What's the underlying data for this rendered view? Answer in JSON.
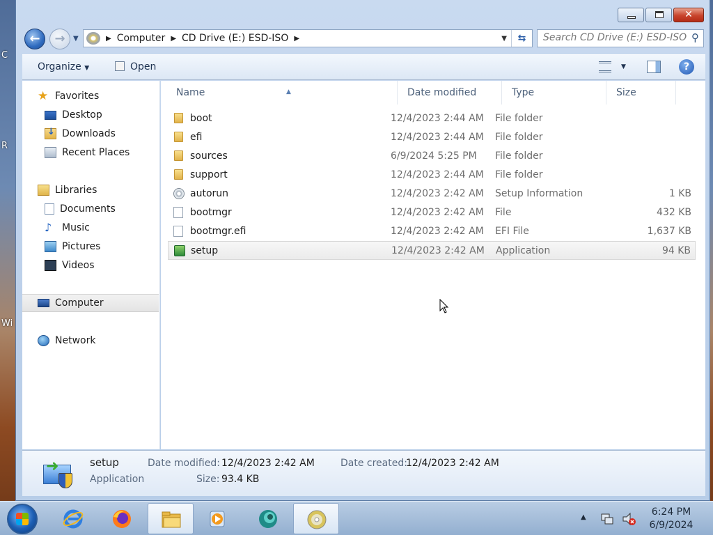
{
  "desktop": {
    "fragments": [
      "C",
      "R",
      "Wi"
    ]
  },
  "window": {
    "nav": {
      "back_glyph": "←",
      "fwd_glyph": "→"
    },
    "address": {
      "crumbs": [
        "Computer",
        "CD Drive (E:) ESD-ISO"
      ],
      "separator": "▶"
    },
    "search": {
      "placeholder": "Search CD Drive (E:) ESD-ISO"
    },
    "toolbar": {
      "organize": "Organize",
      "open": "Open"
    },
    "caption": {
      "close_glyph": "✕"
    }
  },
  "navpane": {
    "favorites": {
      "label": "Favorites",
      "items": [
        "Desktop",
        "Downloads",
        "Recent Places"
      ]
    },
    "libraries": {
      "label": "Libraries",
      "items": [
        "Documents",
        "Music",
        "Pictures",
        "Videos"
      ]
    },
    "computer": "Computer",
    "network": "Network"
  },
  "filelist": {
    "columns": [
      "Name",
      "Date modified",
      "Type",
      "Size"
    ],
    "rows": [
      {
        "name": "boot",
        "date": "12/4/2023 2:44 AM",
        "type": "File folder",
        "size": "",
        "icon": "folder-icon"
      },
      {
        "name": "efi",
        "date": "12/4/2023 2:44 AM",
        "type": "File folder",
        "size": "",
        "icon": "folder-icon"
      },
      {
        "name": "sources",
        "date": "6/9/2024 5:25 PM",
        "type": "File folder",
        "size": "",
        "icon": "folder-icon"
      },
      {
        "name": "support",
        "date": "12/4/2023 2:44 AM",
        "type": "File folder",
        "size": "",
        "icon": "folder-icon"
      },
      {
        "name": "autorun",
        "date": "12/4/2023 2:42 AM",
        "type": "Setup Information",
        "size": "1 KB",
        "icon": "setup-info-icon"
      },
      {
        "name": "bootmgr",
        "date": "12/4/2023 2:42 AM",
        "type": "File",
        "size": "432 KB",
        "icon": "file-icon"
      },
      {
        "name": "bootmgr.efi",
        "date": "12/4/2023 2:42 AM",
        "type": "EFI File",
        "size": "1,637 KB",
        "icon": "file-icon"
      },
      {
        "name": "setup",
        "date": "12/4/2023 2:42 AM",
        "type": "Application",
        "size": "94 KB",
        "icon": "application-icon"
      }
    ],
    "selected_index": 7
  },
  "details": {
    "name": "setup",
    "type": "Application",
    "date_modified_label": "Date modified:",
    "date_modified": "12/4/2023 2:42 AM",
    "date_created_label": "Date created:",
    "date_created": "12/4/2023 2:42 AM",
    "size_label": "Size:",
    "size": "93.4 KB"
  },
  "taskbar": {
    "clock_time": "6:24 PM",
    "clock_date": "6/9/2024"
  }
}
